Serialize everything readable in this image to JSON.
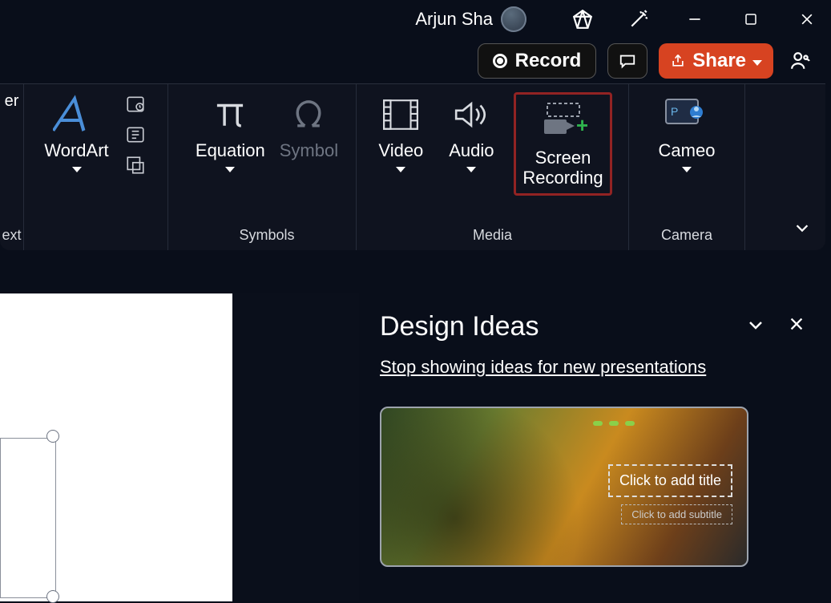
{
  "titlebar": {
    "user_name": "Arjun Sha"
  },
  "cmdbar": {
    "record_label": "Record",
    "share_label": "Share"
  },
  "ribbon": {
    "text_group": {
      "ext_label": "ext",
      "truncated_er": "er"
    },
    "wordart": {
      "label": "WordArt"
    },
    "symbols_group": {
      "label": "Symbols",
      "equation_label": "Equation",
      "symbol_label": "Symbol"
    },
    "media_group": {
      "label": "Media",
      "video_label": "Video",
      "audio_label": "Audio",
      "screen_recording_label": "Screen\nRecording"
    },
    "camera_group": {
      "label": "Camera",
      "cameo_label": "Cameo"
    }
  },
  "design_panel": {
    "title": "Design Ideas",
    "stop_link": "Stop showing ideas for new presentations",
    "title_ph": "Click to add title",
    "subtitle_ph": "Click to add subtitle"
  }
}
